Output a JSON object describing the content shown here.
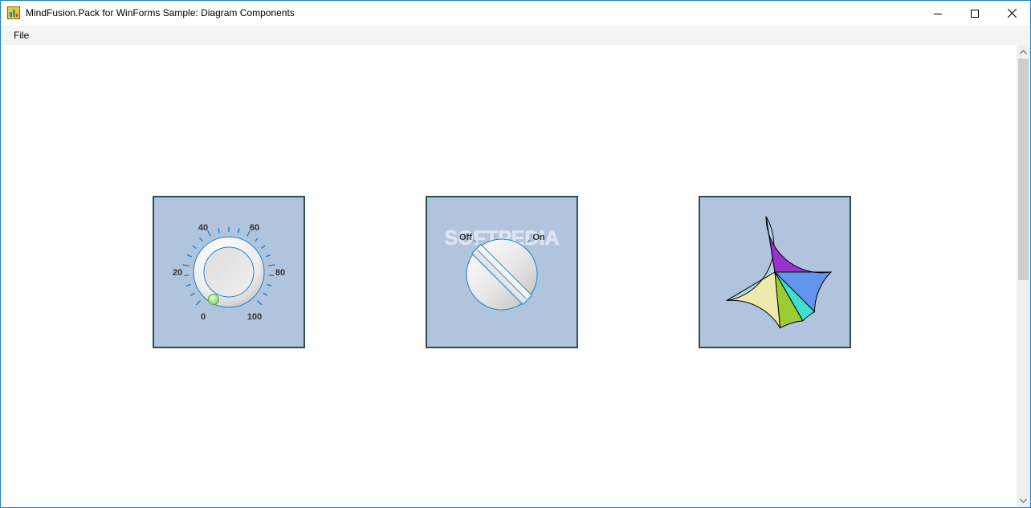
{
  "window": {
    "title": "MindFusion.Pack for WinForms Sample: Diagram Components"
  },
  "menu": {
    "items": [
      {
        "label": "File"
      }
    ]
  },
  "knob": {
    "labels": [
      "0",
      "20",
      "40",
      "60",
      "80",
      "100"
    ],
    "value": 0
  },
  "switch": {
    "off_label": "Off",
    "on_label": "On"
  },
  "watermark": "SOFTPEDIA",
  "pie": {
    "slices": [
      {
        "color": "#6495ed",
        "value": 12.5
      },
      {
        "color": "#40e0d0",
        "value": 4.2
      },
      {
        "color": "#9acd32",
        "value": 6.8
      },
      {
        "color": "#eee8aa",
        "value": 18
      },
      {
        "color": "#add8e6",
        "value": 31
      },
      {
        "color": "#9932cc",
        "value": 27.5
      }
    ]
  },
  "colors": {
    "component_fill": "#b0c4de",
    "component_border": "#2f4f4f",
    "tick_color": "#1e7fc8",
    "window_border": "#1883d7"
  }
}
